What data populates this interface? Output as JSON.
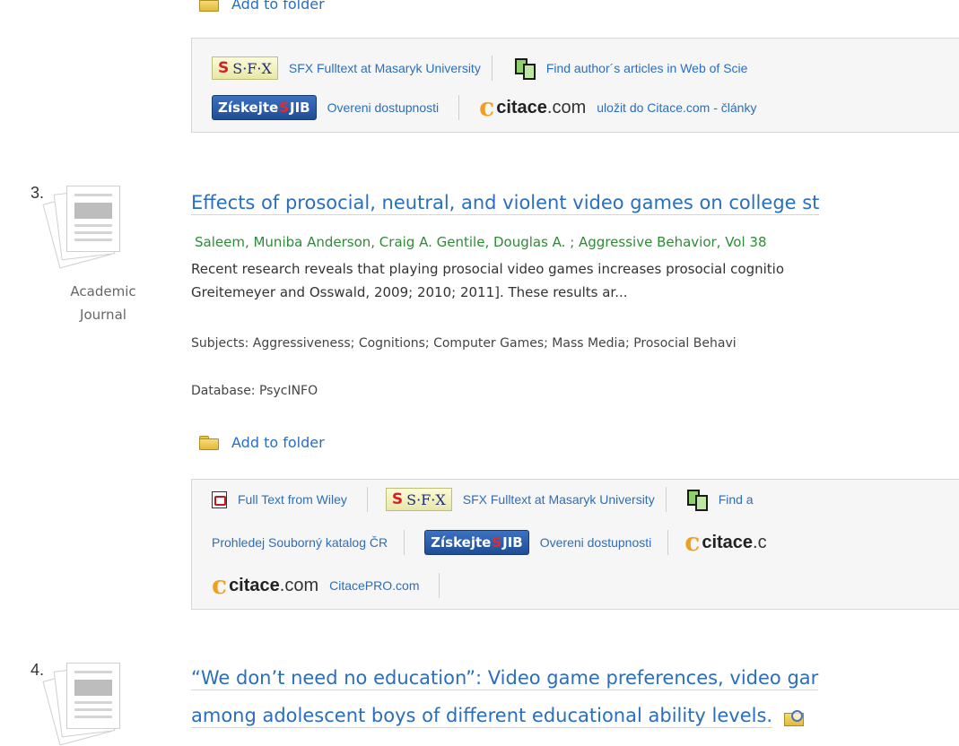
{
  "top_folder": {
    "label": "Add to folder"
  },
  "links_box_1": {
    "sfx_logo": {
      "s": "S",
      "text": "S·F·X"
    },
    "sfx_link": "SFX Fulltext at Masaryk University",
    "wos_link": "Find author´s articles in Web of Scie",
    "jib_logo": {
      "left": "Získejte",
      "s": "S",
      "right": "JIB"
    },
    "jib_link": "Overeni dostupnosti",
    "citace_logo": {
      "c": "c",
      "bold": "citace",
      "light": ".com"
    },
    "citace_link": "uložit do Citace.com - články"
  },
  "result_3": {
    "number": "3.",
    "doc_type": [
      "Academic",
      "Journal"
    ],
    "title": "Effects of prosocial, neutral, and violent video games on college st",
    "authors": "Saleem, Muniba Anderson, Craig A. Gentile, Douglas A. ; Aggressive Behavior, Vol 38",
    "abstract": [
      "Recent research reveals that playing prosocial video games increases prosocial cognitio",
      "Greitemeyer and Osswald, 2009; 2010; 2011]. These results ar..."
    ],
    "subjects": "Subjects: Aggressiveness; Cognitions; Computer Games; Mass Media; Prosocial Behavi",
    "database": "Database: PsycINFO",
    "add_folder": "Add to folder",
    "links": {
      "fulltext_wiley": "Full Text from Wiley",
      "sfx_logo": {
        "s": "S",
        "text": "S·F·X"
      },
      "sfx_link": "SFX Fulltext at Masaryk University",
      "find_partial": "Find a",
      "katalog_link": "Prohledej Souborný katalog ČR",
      "jib_logo": {
        "left": "Získejte",
        "s": "S",
        "right": "JIB"
      },
      "jib_link": "Overeni dostupnosti",
      "citace_partial": {
        "c": "c",
        "bold": "citace",
        "light": ".c"
      },
      "citace_logo": {
        "c": "c",
        "bold": "citace",
        "light": ".com"
      },
      "citacepro_link": "CitacePRO.com"
    }
  },
  "result_4": {
    "number": "4.",
    "title_line1": "“We don’t need no education”: Video game preferences, video gar",
    "title_line2": "among adolescent boys of different educational ability levels."
  }
}
